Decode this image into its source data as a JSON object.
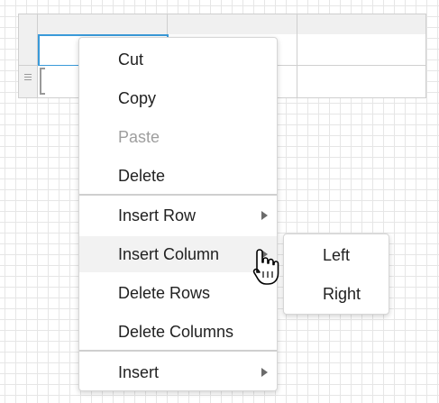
{
  "context_menu": {
    "items": [
      {
        "label": "Cut"
      },
      {
        "label": "Copy"
      },
      {
        "label": "Paste"
      },
      {
        "label": "Delete"
      },
      {
        "label": "Insert Row"
      },
      {
        "label": "Insert Column"
      },
      {
        "label": "Delete Rows"
      },
      {
        "label": "Delete Columns"
      },
      {
        "label": "Insert"
      }
    ]
  },
  "submenu": {
    "items": [
      {
        "label": "Left"
      },
      {
        "label": "Right"
      }
    ]
  },
  "icons": {
    "submenu_arrow": "triangle-right-icon",
    "cursor": "hand-pointer-icon",
    "row_handle": "drag-handle-icon"
  },
  "colors": {
    "selection_border": "#3a9ad9",
    "hover_background": "#f2f2f2",
    "disabled_text": "#9e9e9e"
  }
}
